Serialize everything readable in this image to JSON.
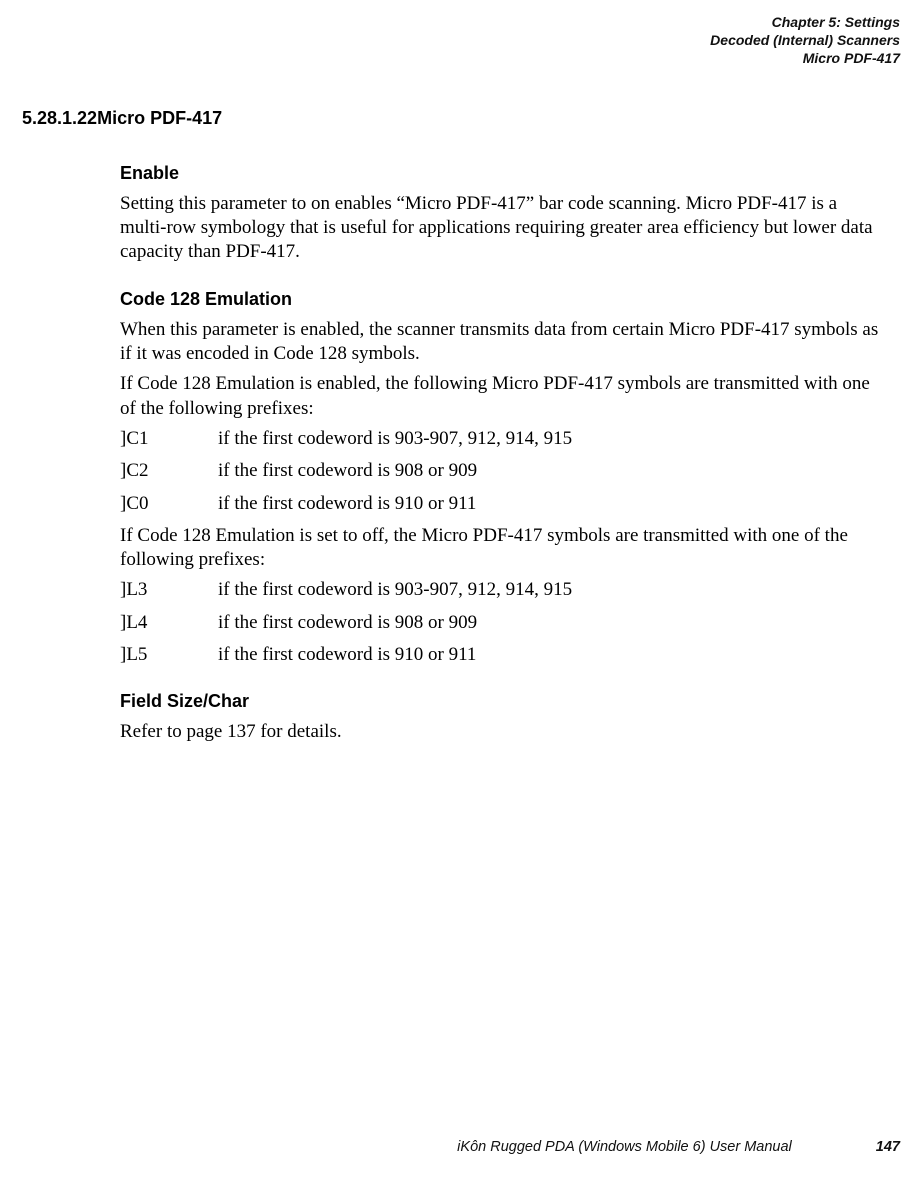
{
  "header": {
    "line1": "Chapter 5:  Settings",
    "line2": "Decoded (Internal) Scanners",
    "line3": "Micro PDF-417"
  },
  "section": {
    "number": "5.28.1.22",
    "title": "Micro PDF-417"
  },
  "enable": {
    "heading": "Enable",
    "para": "Setting this parameter to on enables “Micro PDF-417” bar code scanning. Micro PDF-417 is a multi-row symbology that is useful for applications requiring greater area efficiency but lower data capacity than PDF-417."
  },
  "code128": {
    "heading": "Code 128 Emulation",
    "para1": "When this parameter is enabled, the scanner transmits data from certain Micro PDF-417 symbols as if it was encoded in Code 128 symbols.",
    "para2": "If Code 128 Emulation is enabled, the following Micro PDF-417 symbols are transmitted with one of the following prefixes:",
    "enabled": [
      {
        "code": "]C1",
        "desc": "if the first codeword is 903-907, 912, 914, 915"
      },
      {
        "code": "]C2",
        "desc": "if the first codeword is 908 or 909"
      },
      {
        "code": "]C0",
        "desc": "if the first codeword is 910 or 911"
      }
    ],
    "para3": "If Code 128 Emulation is set to off, the Micro PDF-417 symbols are transmitted with one of the following prefixes:",
    "disabled": [
      {
        "code": "]L3",
        "desc": "if the first codeword is 903-907, 912, 914, 915"
      },
      {
        "code": "]L4",
        "desc": "if the first codeword is 908 or 909"
      },
      {
        "code": "]L5",
        "desc": "if the first codeword is 910 or 911"
      }
    ]
  },
  "fieldsize": {
    "heading": "Field Size/Char",
    "para": "Refer to page 137 for details."
  },
  "footer": {
    "title": "iKôn Rugged PDA (Windows Mobile 6) User Manual",
    "page": "147"
  }
}
